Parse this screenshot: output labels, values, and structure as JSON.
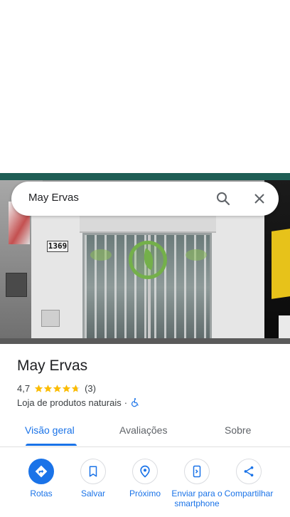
{
  "search": {
    "query": "May Ervas"
  },
  "photo": {
    "house_number": "1369"
  },
  "place": {
    "name": "May Ervas",
    "rating": "4,7",
    "rating_stars": 4.7,
    "review_count": "(3)",
    "category": "Loja de produtos naturais",
    "separator": "·",
    "accessibility_icon": "wheelchair-icon"
  },
  "tabs": [
    {
      "label": "Visão geral",
      "active": true
    },
    {
      "label": "Avaliações",
      "active": false
    },
    {
      "label": "Sobre",
      "active": false
    }
  ],
  "actions": [
    {
      "label": "Rotas",
      "icon": "directions-icon"
    },
    {
      "label": "Salvar",
      "icon": "bookmark-icon"
    },
    {
      "label": "Próximo",
      "icon": "nearby-icon"
    },
    {
      "label": "Enviar para o smartphone",
      "icon": "send-to-phone-icon"
    },
    {
      "label": "Compartilhar",
      "icon": "share-icon"
    }
  ],
  "colors": {
    "accent": "#1a73e8",
    "star": "#fbbc04",
    "text": "#202124",
    "secondary_text": "#5f6368"
  }
}
